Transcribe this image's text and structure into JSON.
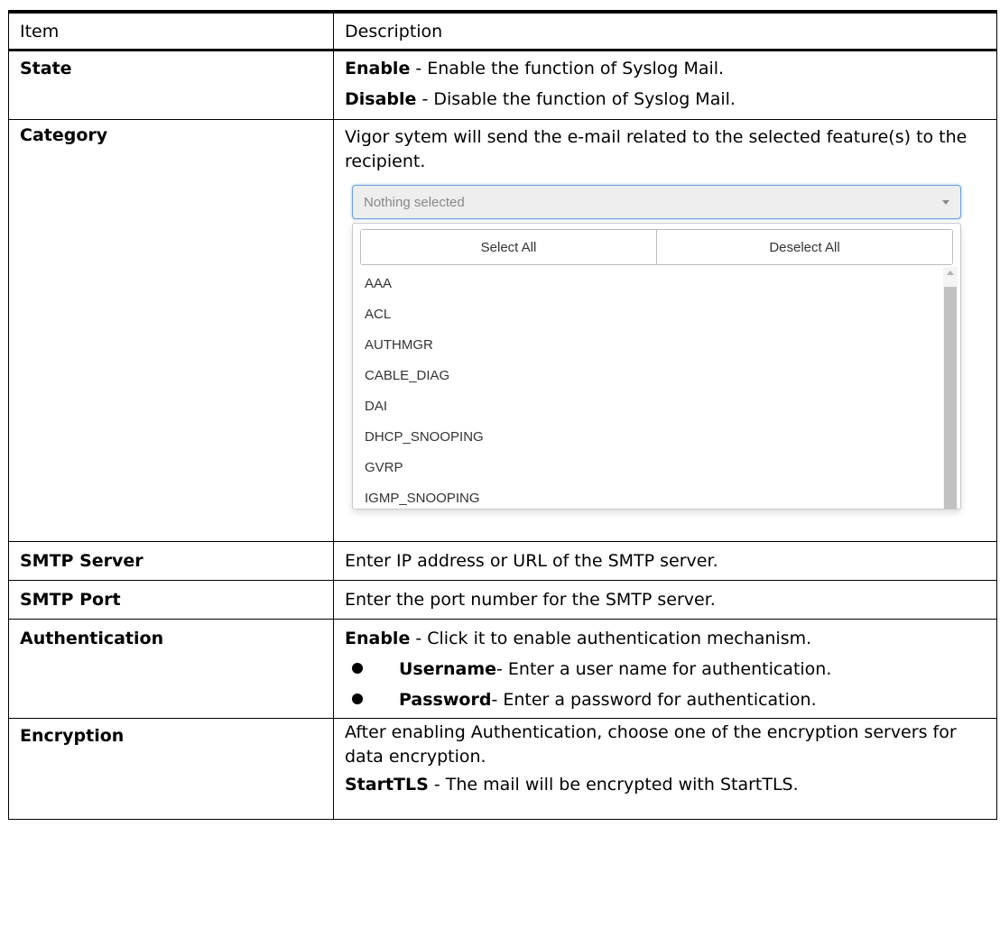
{
  "table": {
    "headers": {
      "item": "Item",
      "description": "Description"
    },
    "state": {
      "label": "State",
      "enable_term": "Enable",
      "enable_text": " - Enable the function of Syslog Mail.",
      "disable_term": "Disable",
      "disable_text": " - Disable the function of Syslog Mail."
    },
    "category": {
      "label": "Category",
      "text": "Vigor sytem will send the e-mail related to the selected feature(s) to the recipient.",
      "dropdown": {
        "placeholder": "Nothing selected",
        "select_all": "Select All",
        "deselect_all": "Deselect All",
        "options": [
          "AAA",
          "ACL",
          "AUTHMGR",
          "CABLE_DIAG",
          "DAI",
          "DHCP_SNOOPING",
          "GVRP",
          "IGMP_SNOOPING"
        ]
      }
    },
    "smtp_server": {
      "label": "SMTP Server",
      "text": "Enter IP address or URL of the SMTP server."
    },
    "smtp_port": {
      "label": "SMTP Port",
      "text": "Enter the port number for the SMTP server."
    },
    "authentication": {
      "label": "Authentication",
      "enable_term": "Enable",
      "enable_text": " - Click it to enable authentication mechanism.",
      "username_term": "Username",
      "username_text": " - Enter a user name for authentication.",
      "password_term": "Password",
      "password_text": " - Enter a password for authentication."
    },
    "encryption": {
      "label": "Encryption",
      "text": "After enabling Authentication, choose one of the encryption servers for data encryption.",
      "starttls_term": "StartTLS",
      "starttls_text": " - The mail will be encrypted with StartTLS."
    }
  }
}
